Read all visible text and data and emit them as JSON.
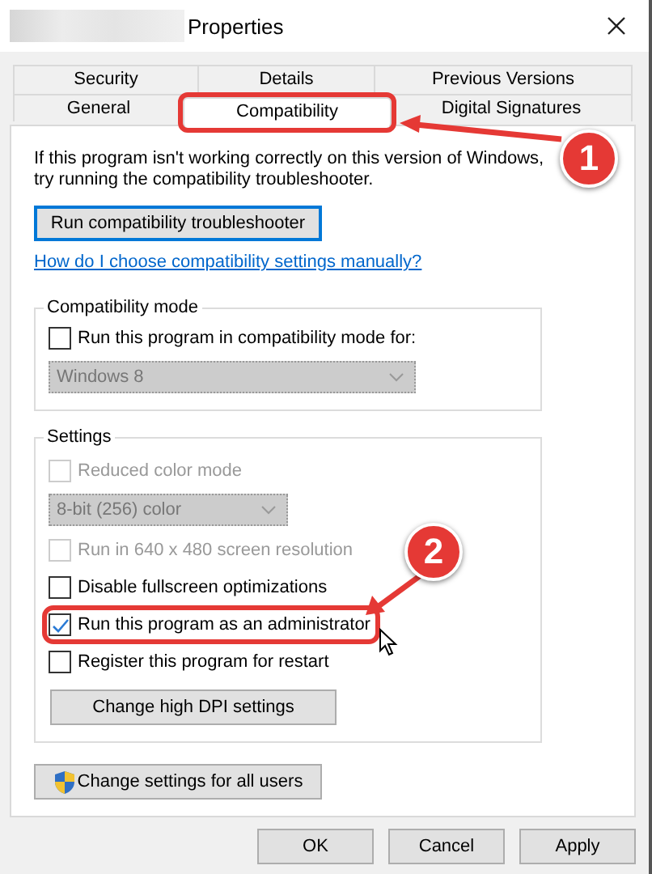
{
  "window": {
    "title": "Properties"
  },
  "tab_rows": [
    {
      "tabs": [
        {
          "label": "Security",
          "selected": false,
          "highlighted": false
        },
        {
          "label": "Details",
          "selected": false,
          "highlighted": false
        },
        {
          "label": "Previous Versions",
          "selected": false,
          "highlighted": false
        }
      ]
    },
    {
      "tabs": [
        {
          "label": "General",
          "selected": false,
          "highlighted": false
        },
        {
          "label": "Compatibility",
          "selected": true,
          "highlighted": true
        },
        {
          "label": "Digital Signatures",
          "selected": false,
          "highlighted": false
        }
      ]
    }
  ],
  "intro": "If this program isn't working correctly on this version of Windows, try running the compatibility troubleshooter.",
  "troubleshooter_button": "Run compatibility troubleshooter",
  "help_link": "How do I choose compatibility settings manually?",
  "compatibility_mode": {
    "title": "Compatibility mode",
    "checkbox": {
      "label": "Run this program in compatibility mode for:",
      "checked": false,
      "disabled": false
    },
    "dropdown": {
      "value": "Windows 8",
      "disabled": true
    }
  },
  "settings": {
    "title": "Settings",
    "items": [
      {
        "kind": "checkbox",
        "label": "Reduced color mode",
        "checked": false,
        "disabled": true,
        "highlighted": false
      },
      {
        "kind": "dropdown",
        "value": "8-bit (256) color",
        "disabled": true
      },
      {
        "kind": "checkbox",
        "label": "Run in 640 x 480 screen resolution",
        "checked": false,
        "disabled": true,
        "highlighted": false
      },
      {
        "kind": "checkbox",
        "label": "Disable fullscreen optimizations",
        "checked": false,
        "disabled": false,
        "highlighted": false
      },
      {
        "kind": "checkbox",
        "label": "Run this program as an administrator",
        "checked": true,
        "disabled": false,
        "highlighted": true
      },
      {
        "kind": "checkbox",
        "label": "Register this program for restart",
        "checked": false,
        "disabled": false,
        "highlighted": false
      },
      {
        "kind": "button",
        "label": "Change high DPI settings"
      }
    ]
  },
  "all_users_button": "Change settings for all users",
  "buttons": [
    "OK",
    "Cancel",
    "Apply"
  ],
  "callouts": [
    {
      "label": "1"
    },
    {
      "label": "2"
    }
  ]
}
